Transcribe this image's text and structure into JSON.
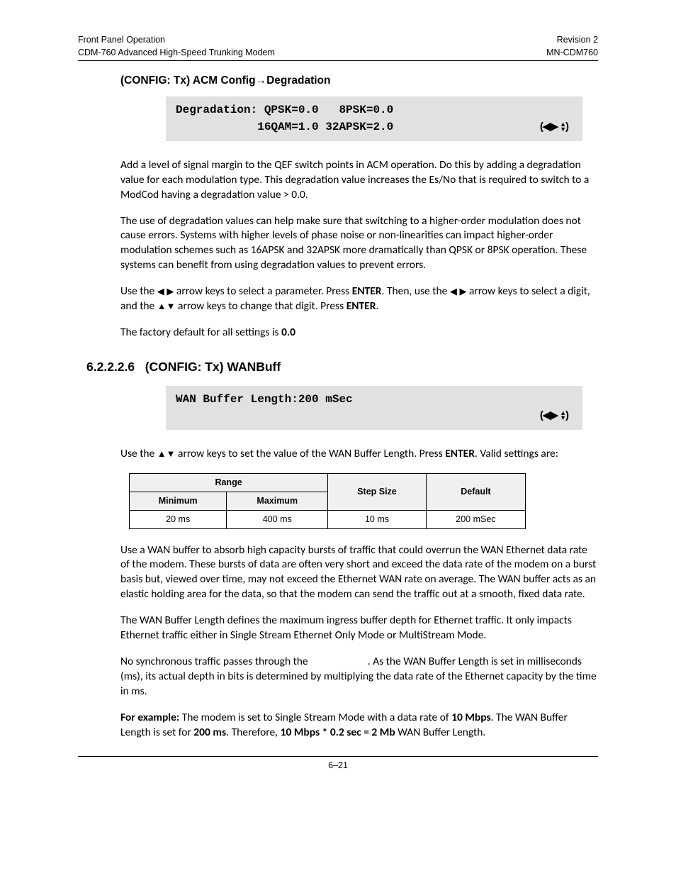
{
  "header": {
    "left1": "Front Panel Operation",
    "left2": "CDM-760 Advanced High-Speed Trunking Modem",
    "right1": "Revision 2",
    "right2": "MN-CDM760"
  },
  "section1": {
    "title_prefix": "(CONFIG: Tx) ACM Config",
    "title_suffix": "Degradation",
    "lcd_line1": "Degradation: QPSK=0.0   8PSK=0.0",
    "lcd_line2": "            16QAM=1.0 32APSK=2.0",
    "lcd_nav": "(◀▶ ◂▸)",
    "para1": "Add a level of signal margin to the QEF switch points in ACM operation. Do this by adding a degradation value for each modulation type. This degradation value increases the Es/No that is required to switch to a ModCod having a degradation value > 0.0.",
    "para2": "The use of degradation values can help make sure that switching to a higher-order modulation does not cause errors. Systems with higher levels of phase noise or non-linearities can impact higher-order modulation schemes such as 16APSK and 32APSK more dramatically than QPSK or 8PSK operation. These systems can benefit from using degradation values to prevent errors.",
    "para3_a": "Use the ",
    "para3_lr": "◀ ▶",
    "para3_b": " arrow keys to select a parameter. Press ",
    "para3_enter1": "ENTER",
    "para3_c": ". Then, use the ",
    "para3_lr2": "◀ ▶",
    "para3_d": "  arrow keys to select a digit, and the ",
    "para3_ud": "▲▼",
    "para3_e": " arrow keys to change that digit. Press ",
    "para3_enter2": "ENTER",
    "para3_f": ".",
    "para4_a": "The factory default for all settings is ",
    "para4_b": "0.0"
  },
  "section2": {
    "number": "6.2.2.2.6",
    "title": "(CONFIG: Tx) WANBuff",
    "lcd_line1": "WAN Buffer Length:200 mSec",
    "lcd_line2_spacer": " ",
    "lcd_nav": "(◀▶ ◂▸)",
    "para1_a": "Use the ",
    "para1_ud": "▲▼",
    "para1_b": " arrow keys to set the value of the WAN Buffer Length. Press ",
    "para1_enter": "ENTER",
    "para1_c": ". Valid settings are:",
    "table": {
      "h_range": "Range",
      "h_min": "Minimum",
      "h_max": "Maximum",
      "h_step": "Step Size",
      "h_default": "Default",
      "r_min": "20 ms",
      "r_max": "400 ms",
      "r_step": "10 ms",
      "r_default": "200 mSec"
    },
    "para2": "Use a WAN buffer to absorb high capacity bursts of traffic that could overrun the WAN Ethernet data rate of the modem. These bursts of data are often very short and exceed the data rate of the modem on a burst basis but, viewed over time, may not exceed the Ethernet WAN rate on average. The WAN buffer acts as an elastic holding area for the data, so that the modem can send the traffic out at a smooth, fixed data rate.",
    "para3": "The WAN Buffer Length defines the maximum ingress buffer depth for Ethernet traffic. It only impacts Ethernet traffic either in Single Stream Ethernet Only Mode or MultiStream Mode.",
    "para4": "No synchronous traffic passes through the                        . As the WAN Buffer Length is set in milliseconds (ms), its actual depth in bits is determined by multiplying the data rate of the Ethernet capacity by the time in ms.",
    "para5_a": "For example:",
    "para5_b": " The modem is set to Single Stream Mode with a data rate of ",
    "para5_c": "10 Mbps",
    "para5_d": ". The WAN Buffer Length is set for ",
    "para5_e": "200 ms",
    "para5_f": ". Therefore, ",
    "para5_g": "10 Mbps * 0.2 sec = 2 Mb",
    "para5_h": " WAN Buffer Length."
  },
  "footer": "6–21"
}
